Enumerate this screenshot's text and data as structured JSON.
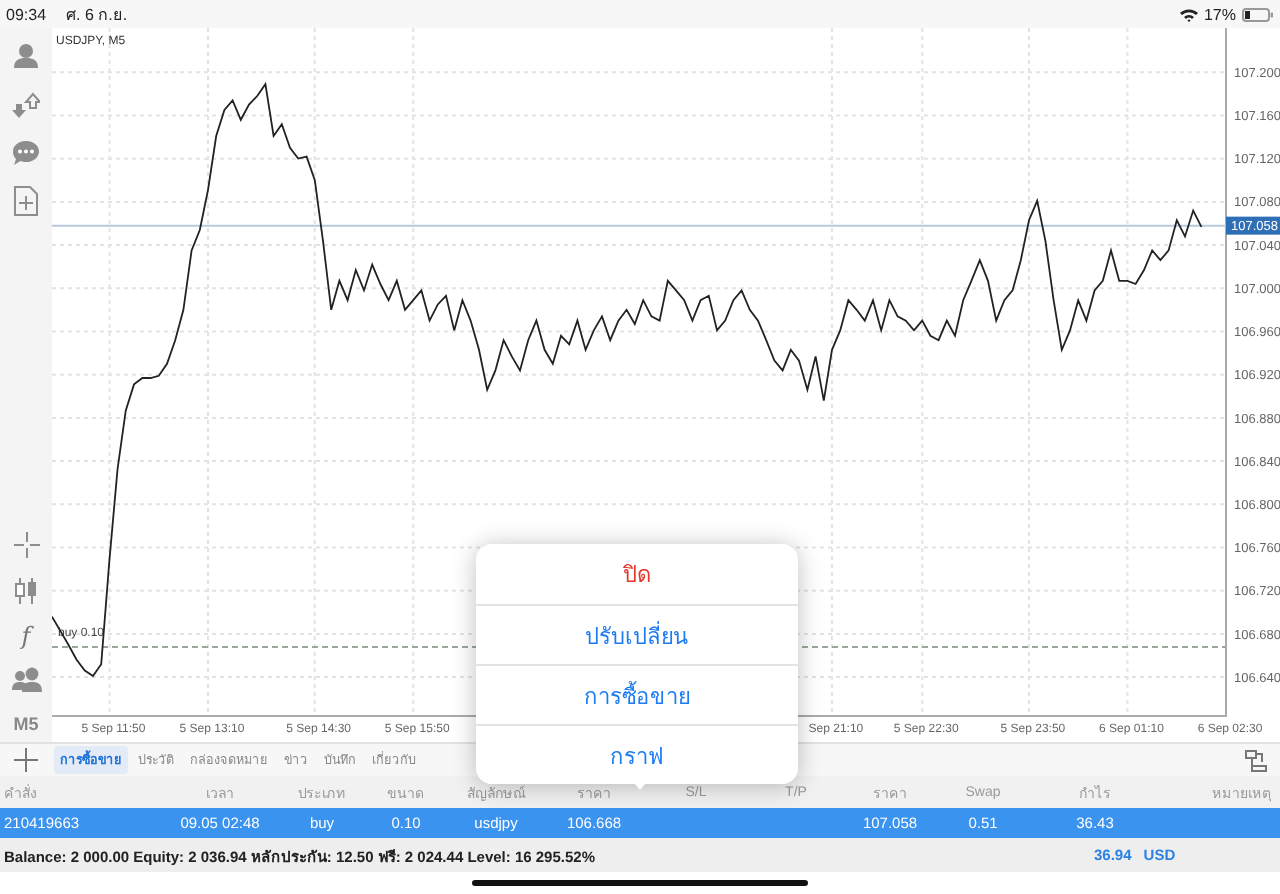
{
  "status_bar": {
    "time": "09:34",
    "date": "ศ. 6 ก.ย.",
    "battery": "17%"
  },
  "toolbar": {
    "indicator_symbol": "f",
    "timeframe": "M5"
  },
  "chart": {
    "chart_data": {
      "type": "line",
      "title": "USDJPY, M5",
      "grid": true,
      "categories": [
        null,
        null,
        null,
        null,
        null,
        null,
        null,
        "5 Sep 11:50",
        null,
        null,
        null,
        null,
        null,
        null,
        null,
        null,
        null,
        null,
        null,
        "5 Sep 13:10",
        null,
        null,
        null,
        null,
        null,
        null,
        null,
        null,
        null,
        null,
        null,
        null,
        "5 Sep 14:30",
        null,
        null,
        null,
        null,
        null,
        null,
        null,
        null,
        null,
        null,
        null,
        "5 Sep 15:50",
        null,
        null,
        null,
        null,
        null,
        null,
        null,
        null,
        null,
        null,
        null,
        null,
        null,
        null,
        null,
        null,
        null,
        null,
        null,
        null,
        null,
        null,
        null,
        null,
        null,
        null,
        null,
        null,
        null,
        null,
        null,
        null,
        null,
        null,
        null,
        null,
        null,
        null,
        null,
        null,
        null,
        null,
        null,
        null,
        null,
        null,
        null,
        null,
        null,
        null,
        "Sep 21:10",
        null,
        null,
        null,
        null,
        null,
        null,
        null,
        null,
        null,
        null,
        "5 Sep 22:30",
        null,
        null,
        null,
        null,
        null,
        null,
        null,
        null,
        null,
        null,
        null,
        null,
        "5 Sep 23:50",
        null,
        null,
        null,
        null,
        null,
        null,
        null,
        null,
        null,
        null,
        null,
        "6 Sep 01:10",
        null,
        null,
        null,
        null,
        null,
        null,
        null,
        null,
        null,
        null,
        null,
        "6 Sep 02:30"
      ],
      "series": [
        {
          "color": "#222222",
          "values": [
            106.696,
            106.683,
            106.67,
            106.656,
            106.646,
            106.641,
            106.652,
            106.748,
            106.833,
            106.887,
            106.911,
            106.917,
            106.917,
            106.919,
            106.93,
            106.952,
            106.98,
            107.035,
            107.054,
            107.091,
            107.141,
            107.165,
            107.174,
            107.156,
            107.17,
            107.178,
            107.189,
            107.141,
            107.152,
            107.13,
            107.12,
            107.122,
            107.1,
            107.044,
            106.98,
            107.007,
            106.989,
            107.017,
            106.998,
            107.022,
            107.004,
            106.989,
            107.007,
            106.98,
            106.989,
            106.998,
            106.97,
            106.985,
            106.993,
            106.961,
            106.989,
            106.97,
            106.943,
            106.906,
            106.924,
            106.952,
            106.937,
            106.924,
            106.952,
            106.97,
            106.943,
            106.93,
            106.956,
            106.948,
            106.97,
            106.943,
            106.961,
            106.974,
            106.952,
            106.97,
            106.98,
            106.967,
            106.989,
            106.974,
            106.97,
            107.007,
            106.998,
            106.989,
            106.97,
            106.989,
            106.993,
            106.961,
            106.97,
            106.989,
            106.998,
            106.98,
            106.97,
            106.952,
            106.933,
            106.924,
            106.943,
            106.933,
            106.906,
            106.937,
            106.896,
            106.943,
            106.961,
            106.989,
            106.98,
            106.97,
            106.989,
            106.961,
            106.989,
            106.974,
            106.97,
            106.961,
            106.97,
            106.956,
            106.952,
            106.97,
            106.956,
            106.989,
            107.007,
            107.026,
            107.007,
            106.97,
            106.989,
            106.998,
            107.026,
            107.063,
            107.081,
            107.044,
            106.989,
            106.943,
            106.961,
            106.989,
            106.97,
            106.998,
            107.007,
            107.035,
            107.007,
            107.007,
            107.004,
            107.017,
            107.035,
            107.026,
            107.035,
            107.063,
            107.048,
            107.072,
            107.057,
            null,
            null,
            null
          ]
        }
      ],
      "ylim": [
        106.604,
        107.241
      ],
      "yticks": [
        {
          "value": 107.2,
          "label": "107.200"
        },
        {
          "value": 107.16,
          "label": "107.160"
        },
        {
          "value": 107.12,
          "label": "107.120"
        },
        {
          "value": 107.08,
          "label": "107.080"
        },
        {
          "value": 107.04,
          "label": "107.040"
        },
        {
          "value": 107.0,
          "label": "107.000"
        },
        {
          "value": 106.96,
          "label": "106.960"
        },
        {
          "value": 106.92,
          "label": "106.920"
        },
        {
          "value": 106.88,
          "label": "106.880"
        },
        {
          "value": 106.84,
          "label": "106.840"
        },
        {
          "value": 106.8,
          "label": "106.800"
        },
        {
          "value": 106.76,
          "label": "106.760"
        },
        {
          "value": 106.72,
          "label": "106.720"
        },
        {
          "value": 106.68,
          "label": "106.680"
        },
        {
          "value": 106.64,
          "label": "106.640"
        }
      ],
      "ref_lines": [
        {
          "axis": "y",
          "value": 107.058,
          "label": "107.058"
        },
        {
          "axis": "y",
          "value": 106.668,
          "label": "buy 0.10"
        }
      ]
    }
  },
  "tabs": [
    {
      "label": "การซื้อขาย",
      "selected": true
    },
    {
      "label": "ประวัติ",
      "selected": false
    },
    {
      "label": "กล่องจดหมาย",
      "selected": false
    },
    {
      "label": "ข่าว",
      "selected": false
    },
    {
      "label": "บันทึก",
      "selected": false
    },
    {
      "label": "เกี่ยวกับ",
      "selected": false
    }
  ],
  "table": {
    "columns": [
      "คำสั่ง",
      "เวลา",
      "ประเภท",
      "ขนาด",
      "สัญลักษณ์",
      "ราคา",
      "S/L",
      "T/P",
      "ราคา",
      "Swap",
      "กำไร",
      "หมายเหตุ"
    ],
    "rows": [
      {
        "selected": true,
        "cells": [
          "210419663",
          "09.05 02:48",
          "buy",
          "0.10",
          "usdjpy",
          "106.668",
          null,
          null,
          "107.058",
          "0.51",
          "36.43",
          null
        ]
      }
    ]
  },
  "summary": {
    "text": "Balance: 2 000.00 Equity: 2 036.94 หลักประกัน: 12.50 ฟรี: 2 024.44 Level: 16 295.52%",
    "total": "36.94",
    "currency": "USD"
  },
  "popup_menu": {
    "items": [
      {
        "label": "ปิด",
        "kind": "destructive"
      },
      {
        "label": "ปรับเปลี่ยน",
        "kind": "action"
      },
      {
        "label": "การซื้อขาย",
        "kind": "action"
      },
      {
        "label": "กราฟ",
        "kind": "action"
      }
    ]
  }
}
